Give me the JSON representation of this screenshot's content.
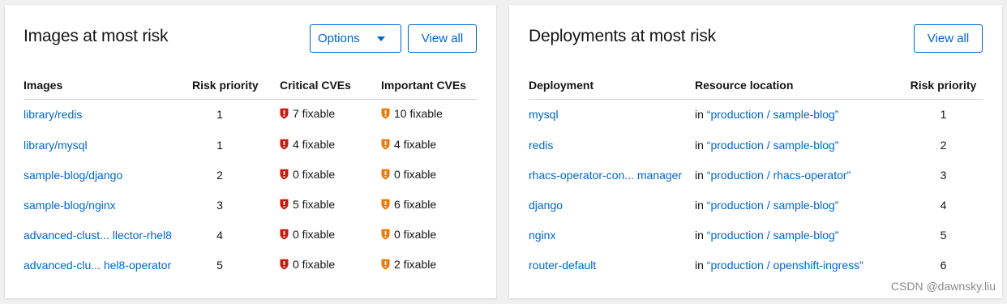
{
  "images_card": {
    "title": "Images at most risk",
    "options_label": "Options",
    "view_all_label": "View all",
    "columns": [
      "Images",
      "Risk priority",
      "Critical CVEs",
      "Important CVEs"
    ],
    "rows": [
      {
        "image": "library/redis",
        "risk": "1",
        "critical": "7 fixable",
        "important": "10 fixable"
      },
      {
        "image": "library/mysql",
        "risk": "1",
        "critical": "4 fixable",
        "important": "4 fixable"
      },
      {
        "image": "sample-blog/django",
        "risk": "2",
        "critical": "0 fixable",
        "important": "0 fixable"
      },
      {
        "image": "sample-blog/nginx",
        "risk": "3",
        "critical": "5 fixable",
        "important": "6 fixable"
      },
      {
        "image": "advanced-clust... llector-rhel8",
        "risk": "4",
        "critical": "0 fixable",
        "important": "0 fixable"
      },
      {
        "image": "advanced-clu... hel8-operator",
        "risk": "5",
        "critical": "0 fixable",
        "important": "2 fixable"
      }
    ]
  },
  "deployments_card": {
    "title": "Deployments at most risk",
    "view_all_label": "View all",
    "columns": [
      "Deployment",
      "Resource location",
      "Risk priority"
    ],
    "location_prefix": "in",
    "rows": [
      {
        "deployment": "mysql",
        "location": "“production / sample-blog”",
        "risk": "1"
      },
      {
        "deployment": "redis",
        "location": "“production / sample-blog”",
        "risk": "2"
      },
      {
        "deployment": "rhacs-operator-con... manager",
        "location": "“production / rhacs-operator”",
        "risk": "3"
      },
      {
        "deployment": "django",
        "location": "“production / sample-blog”",
        "risk": "4"
      },
      {
        "deployment": "nginx",
        "location": "“production / sample-blog”",
        "risk": "5"
      },
      {
        "deployment": "router-default",
        "location": "“production / openshift-ingress”",
        "risk": "6"
      }
    ]
  },
  "icons": {
    "critical": "critical-shield-icon",
    "important": "important-shield-icon"
  },
  "colors": {
    "link": "#0066cc",
    "critical": "#c9190b",
    "important": "#ec7a08",
    "background": "#f0f0f0"
  },
  "watermark": "CSDN @dawnsky.liu"
}
